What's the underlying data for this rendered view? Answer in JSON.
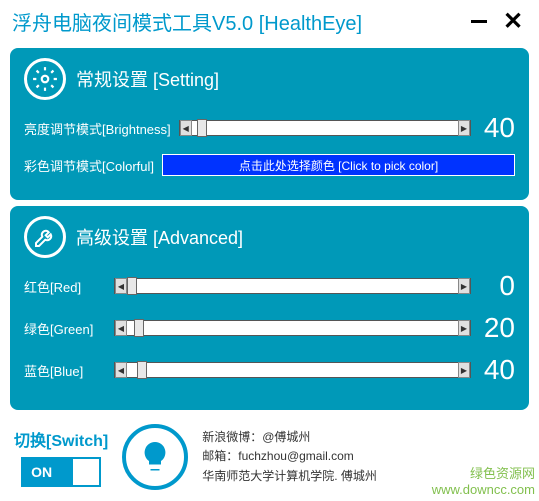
{
  "window": {
    "title": "浮舟电脑夜间模式工具V5.0 [HealthEye]"
  },
  "setting": {
    "header": "常规设置 [Setting]",
    "brightness_label": "亮度调节模式[Brightness]",
    "brightness_value": "40",
    "colorful_label": "彩色调节模式[Colorful]",
    "color_picker_text": "点击此处选择颜色 [Click to pick color]"
  },
  "advanced": {
    "header": "高级设置 [Advanced]",
    "red_label": "红色[Red]",
    "red_value": "0",
    "green_label": "绿色[Green]",
    "green_value": "20",
    "blue_label": "蓝色[Blue]",
    "blue_value": "40"
  },
  "switch": {
    "label": "切换[Switch]",
    "state": "ON"
  },
  "credits": {
    "line1": "新浪微博：@傅城州",
    "line2": "邮箱：fuchzhou@gmail.com",
    "line3": "华南师范大学计算机学院. 傅城州"
  },
  "watermark": "绿色资源网\nwww.downcc.com"
}
